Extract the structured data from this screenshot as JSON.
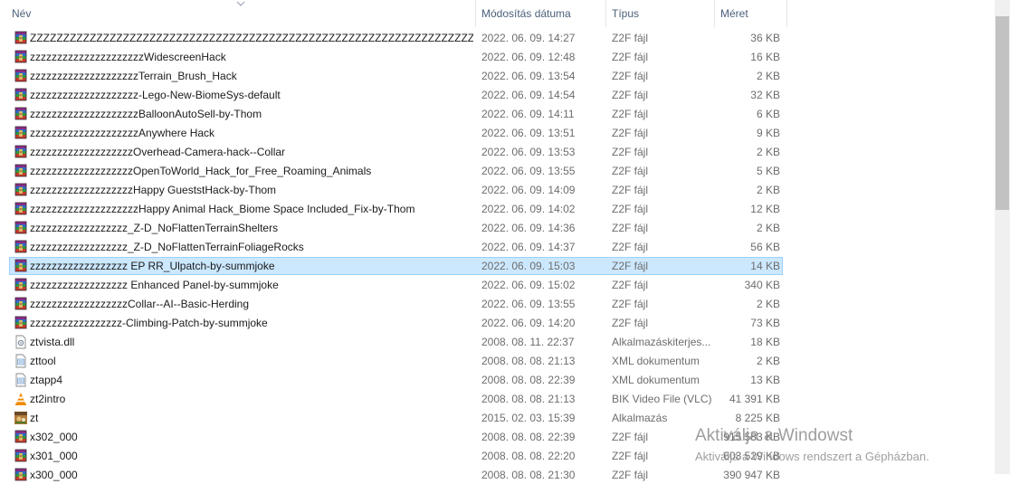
{
  "columns": {
    "name": "Név",
    "date": "Módosítás dátuma",
    "type": "Típus",
    "size": "Méret"
  },
  "files": [
    {
      "name": "ZZZZZZZZZZZZZZZZZZZZZZZZZZZZZZZZZZZZZZZZZZZZZZZZZZZZZZZZZZZZZZZZZZZZZZZZ_NickTerra...",
      "date": "2022. 06. 09. 14:27",
      "type": "Z2F fájl",
      "size": "36 KB",
      "icon": "winrar-archive-icon"
    },
    {
      "name": "zzzzzzzzzzzzzzzzzzzzzWidescreenHack",
      "date": "2022. 06. 09. 12:48",
      "type": "Z2F fájl",
      "size": "16 KB",
      "icon": "winrar-archive-icon"
    },
    {
      "name": "zzzzzzzzzzzzzzzzzzzzTerrain_Brush_Hack",
      "date": "2022. 06. 09. 13:54",
      "type": "Z2F fájl",
      "size": "2 KB",
      "icon": "winrar-archive-icon"
    },
    {
      "name": "zzzzzzzzzzzzzzzzzzzz-Lego-New-BiomeSys-default",
      "date": "2022. 06. 09. 14:54",
      "type": "Z2F fájl",
      "size": "32 KB",
      "icon": "winrar-archive-icon"
    },
    {
      "name": "zzzzzzzzzzzzzzzzzzzzBalloonAutoSell-by-Thom",
      "date": "2022. 06. 09. 14:11",
      "type": "Z2F fájl",
      "size": "6 KB",
      "icon": "winrar-archive-icon"
    },
    {
      "name": "zzzzzzzzzzzzzzzzzzzzAnywhere Hack",
      "date": "2022. 06. 09. 13:51",
      "type": "Z2F fájl",
      "size": "9 KB",
      "icon": "winrar-archive-icon"
    },
    {
      "name": "zzzzzzzzzzzzzzzzzzzOverhead-Camera-hack--Collar",
      "date": "2022. 06. 09. 13:53",
      "type": "Z2F fájl",
      "size": "2 KB",
      "icon": "winrar-archive-icon"
    },
    {
      "name": "zzzzzzzzzzzzzzzzzzzOpenToWorld_Hack_for_Free_Roaming_Animals",
      "date": "2022. 06. 09. 13:55",
      "type": "Z2F fájl",
      "size": "5 KB",
      "icon": "winrar-archive-icon"
    },
    {
      "name": "zzzzzzzzzzzzzzzzzzzHappy GueststHack-by-Thom",
      "date": "2022. 06. 09. 14:09",
      "type": "Z2F fájl",
      "size": "2 KB",
      "icon": "winrar-archive-icon"
    },
    {
      "name": "zzzzzzzzzzzzzzzzzzzzHappy Animal Hack_Biome Space Included_Fix-by-Thom",
      "date": "2022. 06. 09. 14:02",
      "type": "Z2F fájl",
      "size": "12 KB",
      "icon": "winrar-archive-icon"
    },
    {
      "name": "zzzzzzzzzzzzzzzzzz_Z-D_NoFlattenTerrainShelters",
      "date": "2022. 06. 09. 14:36",
      "type": "Z2F fájl",
      "size": "2 KB",
      "icon": "winrar-archive-icon"
    },
    {
      "name": "zzzzzzzzzzzzzzzzzz_Z-D_NoFlattenTerrainFoliageRocks",
      "date": "2022. 06. 09. 14:37",
      "type": "Z2F fájl",
      "size": "56 KB",
      "icon": "winrar-archive-icon"
    },
    {
      "name": "zzzzzzzzzzzzzzzzzz EP RR_Ulpatch-by-summjoke",
      "date": "2022. 06. 09. 15:03",
      "type": "Z2F fájl",
      "size": "14 KB",
      "icon": "winrar-archive-icon",
      "selected": true
    },
    {
      "name": "zzzzzzzzzzzzzzzzzz Enhanced Panel-by-summjoke",
      "date": "2022. 06. 09. 15:02",
      "type": "Z2F fájl",
      "size": "340 KB",
      "icon": "winrar-archive-icon"
    },
    {
      "name": "zzzzzzzzzzzzzzzzzzCollar--AI--Basic-Herding",
      "date": "2022. 06. 09. 13:55",
      "type": "Z2F fájl",
      "size": "2 KB",
      "icon": "winrar-archive-icon"
    },
    {
      "name": "zzzzzzzzzzzzzzzzz-Climbing-Patch-by-summjoke",
      "date": "2022. 06. 09. 14:20",
      "type": "Z2F fájl",
      "size": "73 KB",
      "icon": "winrar-archive-icon"
    },
    {
      "name": "ztvista.dll",
      "date": "2008. 08. 11. 22:37",
      "type": "Alkalmazáskiterjes...",
      "size": "18 KB",
      "icon": "dll-file-icon"
    },
    {
      "name": "zttool",
      "date": "2008. 08. 08. 21:13",
      "type": "XML dokumentum",
      "size": "2 KB",
      "icon": "xml-document-icon"
    },
    {
      "name": "ztapp4",
      "date": "2008. 08. 08. 22:39",
      "type": "XML dokumentum",
      "size": "13 KB",
      "icon": "xml-document-icon"
    },
    {
      "name": "zt2intro",
      "date": "2008. 08. 08. 21:13",
      "type": "BIK Video File (VLC)",
      "size": "41 391 KB",
      "icon": "vlc-cone-icon"
    },
    {
      "name": "zt",
      "date": "2015. 02. 03. 15:39",
      "type": "Alkalmazás",
      "size": "8 225 KB",
      "icon": "application-icon"
    },
    {
      "name": "x302_000",
      "date": "2008. 08. 08. 22:39",
      "type": "Z2F fájl",
      "size": "915 583 KB",
      "icon": "winrar-archive-icon"
    },
    {
      "name": "x301_000",
      "date": "2008. 08. 08. 22:20",
      "type": "Z2F fájl",
      "size": "603 529 KB",
      "icon": "winrar-archive-icon"
    },
    {
      "name": "x300_000",
      "date": "2008. 08. 08. 21:30",
      "type": "Z2F fájl",
      "size": "390 947 KB",
      "icon": "winrar-archive-icon"
    }
  ],
  "watermark": {
    "title": "Aktiválja a Windowst",
    "subtitle": "Aktiválja a Windows rendszert a Gépházban."
  },
  "colors": {
    "selection_bg": "#cce8ff",
    "selection_border": "#99d1ff",
    "header_text": "#4c607a"
  }
}
